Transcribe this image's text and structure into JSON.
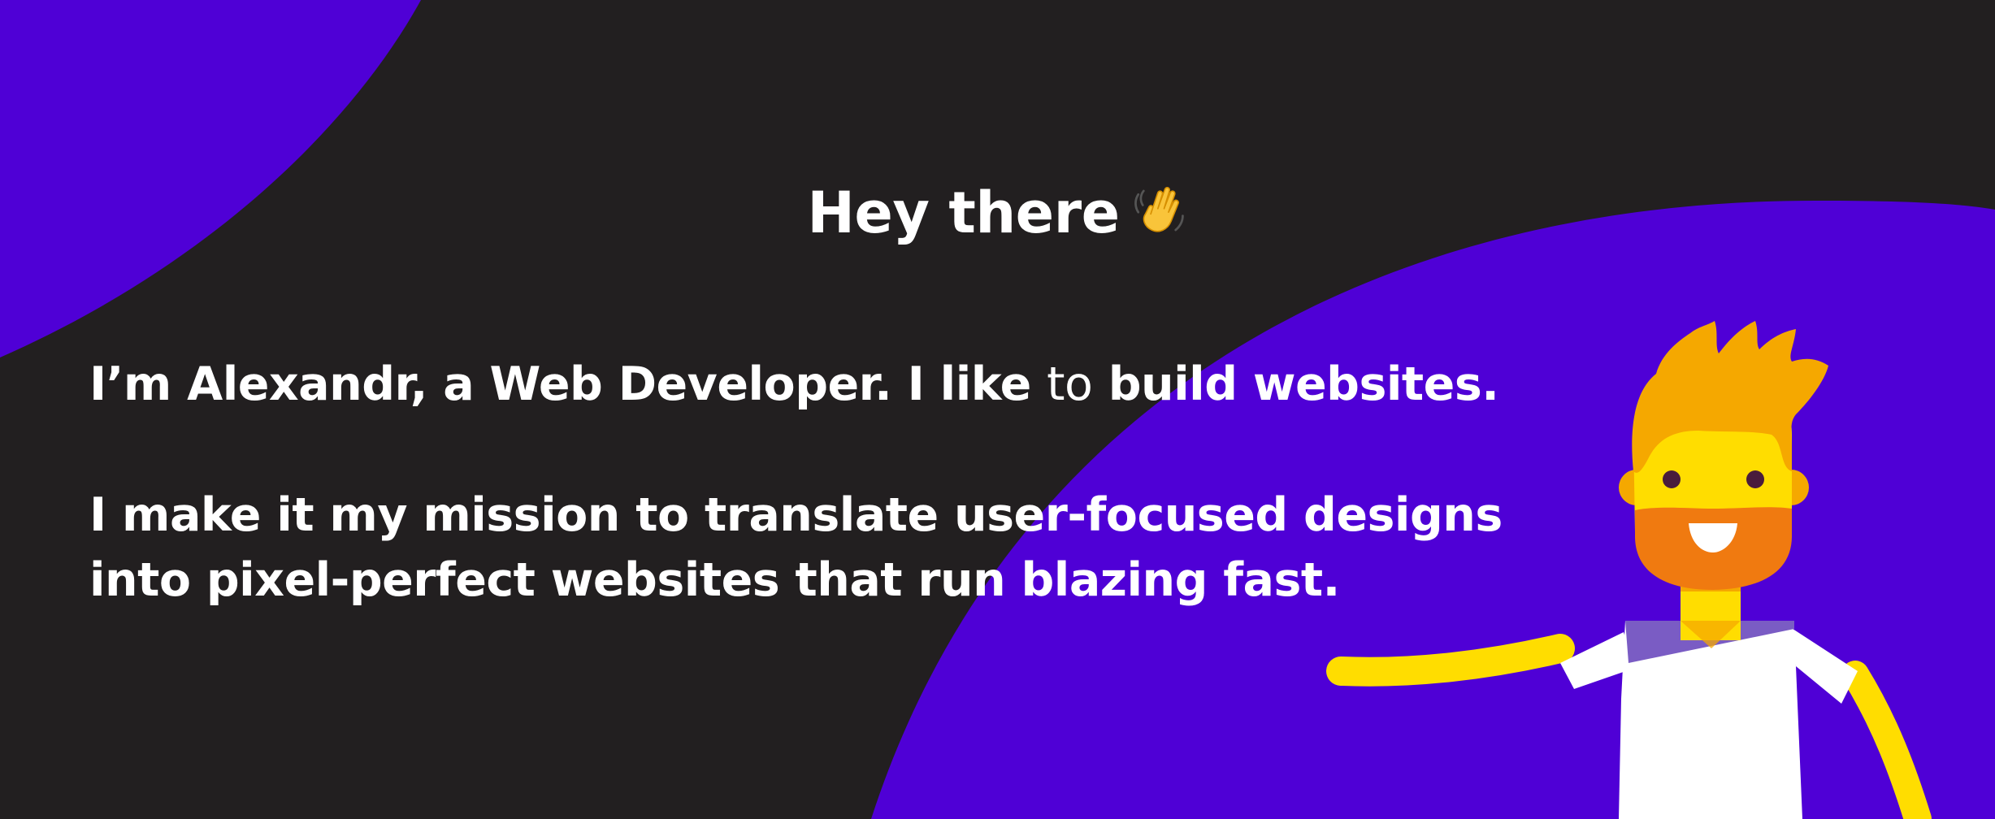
{
  "hero": {
    "greeting": "Hey there",
    "intro": {
      "part1": "I’m Alexandr, a Web Developer. I like",
      "part2": "to",
      "part3": "build websites."
    },
    "mission": {
      "line1": "I make it my mission to translate user-focused designs",
      "line2": "into pixel-perfect websites that run blazing fast."
    }
  },
  "icons": {
    "greeting_emoji": "waving-hand-icon",
    "illustration": "waving-developer-character"
  },
  "colors": {
    "background": "#221f20",
    "accent": "#4f00d6",
    "text": "#ffffff",
    "skin": "#ffdd00",
    "hair": "#f5a800",
    "beard": "#f07a10",
    "shirt": "#ffffff"
  }
}
